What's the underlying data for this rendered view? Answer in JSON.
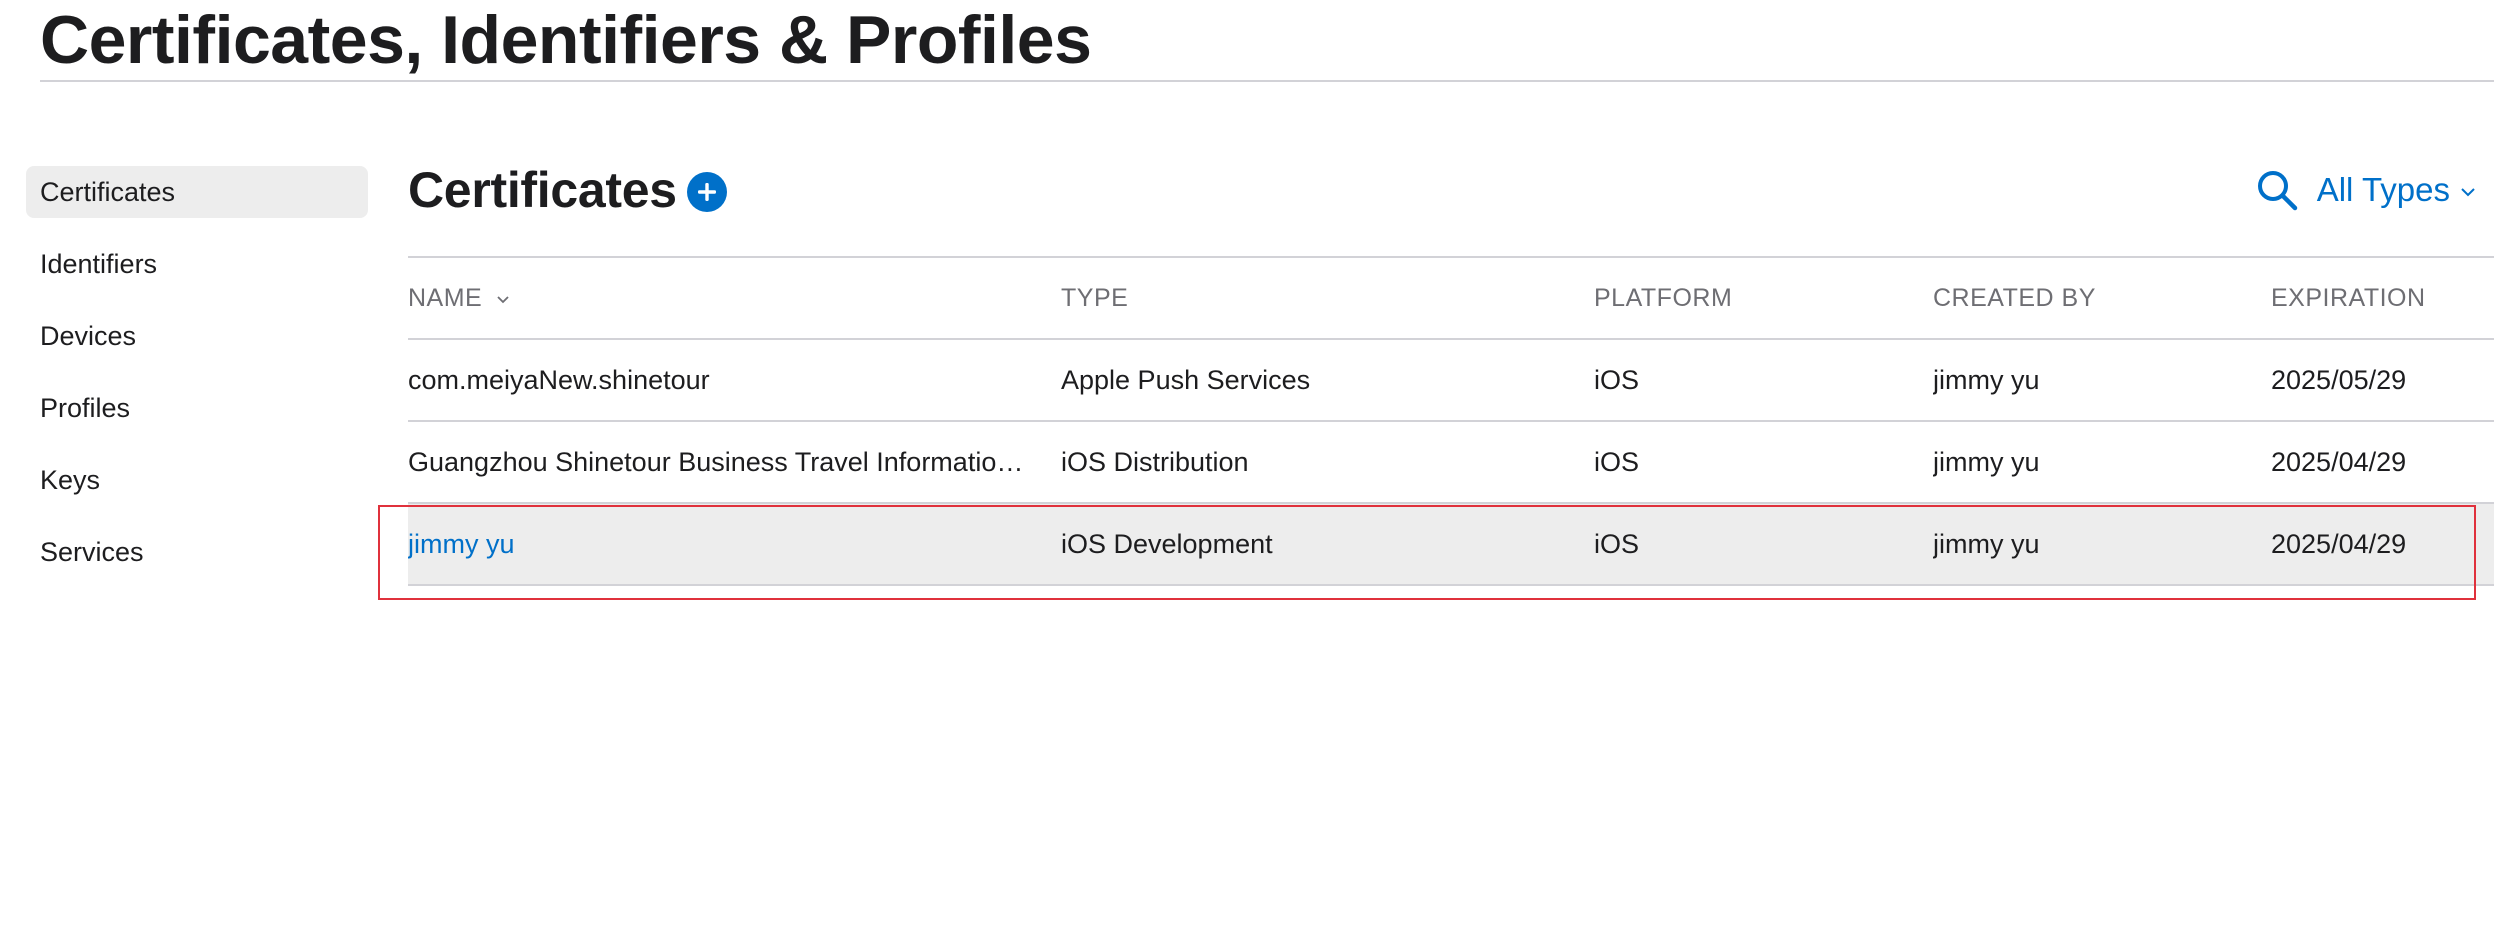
{
  "page_title": "Certificates, Identifiers & Profiles",
  "sidebar": {
    "items": [
      {
        "label": "Certificates",
        "active": true
      },
      {
        "label": "Identifiers"
      },
      {
        "label": "Devices"
      },
      {
        "label": "Profiles"
      },
      {
        "label": "Keys"
      },
      {
        "label": "Services"
      }
    ]
  },
  "section": {
    "title": "Certificates",
    "add_icon": "plus-circle-icon",
    "search_icon": "search-icon",
    "filter_label": "All Types"
  },
  "table": {
    "columns": [
      "NAME",
      "TYPE",
      "PLATFORM",
      "CREATED BY",
      "EXPIRATION"
    ],
    "sorted_column": "NAME",
    "rows": [
      {
        "name": "com.meiyaNew.shinetour",
        "type": "Apple Push Services",
        "platform": "iOS",
        "created_by": "jimmy yu",
        "expiration": "2025/05/29"
      },
      {
        "name": "Guangzhou Shinetour Business Travel Information...",
        "type": "iOS Distribution",
        "platform": "iOS",
        "created_by": "jimmy yu",
        "expiration": "2025/04/29"
      },
      {
        "name": "jimmy yu",
        "type": "iOS Development",
        "platform": "iOS",
        "created_by": "jimmy yu",
        "expiration": "2025/04/29",
        "selected": true
      }
    ]
  },
  "colors": {
    "accent": "#0070c9",
    "highlight_border": "#e0313c",
    "selected_bg": "#ededed",
    "divider": "#d2d2d7"
  }
}
